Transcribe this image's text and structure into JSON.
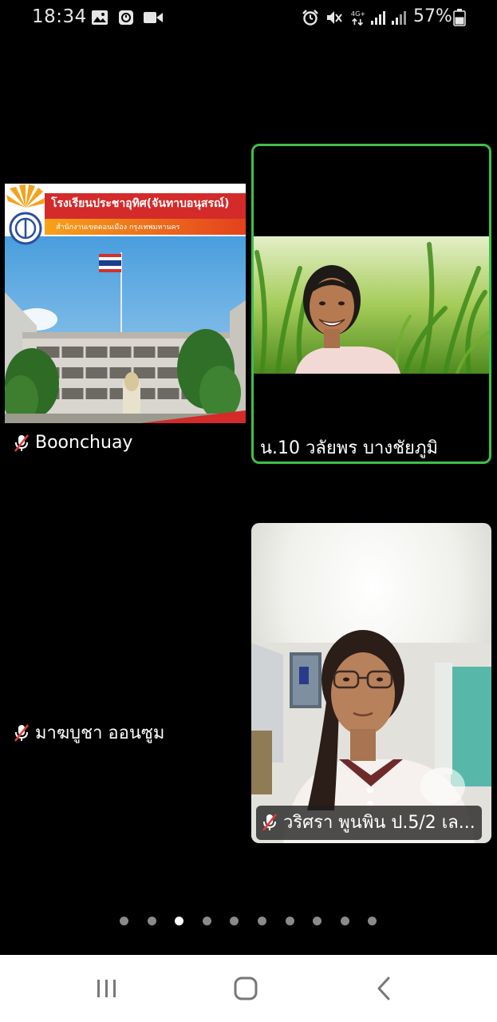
{
  "status_bar": {
    "time": "18:34",
    "left_icons": [
      "image-icon",
      "timer-icon",
      "video-icon"
    ],
    "right_icons": [
      "alarm-icon",
      "mute-vibrate-icon",
      "network-4g-plus-icon",
      "signal-icon",
      "signal-icon-2",
      "battery-icon"
    ],
    "network_label": "4G+",
    "battery_percent": "57%"
  },
  "participants": [
    {
      "name": "Boonchuay",
      "muted": true,
      "speaking": false,
      "video": "school-banner"
    },
    {
      "name": "น.10 วลัยพร บางชัยภูมิ",
      "muted": false,
      "speaking": true,
      "video": "camera"
    },
    {
      "name": "มาฆบูชา ออนซูม",
      "muted": true,
      "speaking": false,
      "video": "off"
    },
    {
      "name": "วริศรา พูนพิน ป.5/2 เล...",
      "muted": true,
      "speaking": false,
      "video": "camera"
    }
  ],
  "shared_banner": {
    "title": "โรงเรียนประชาอุทิศ(จันทาบอนุสรณ์)",
    "subtitle": "สำนักงานเขตดอนเมือง กรุงเทพมหานคร"
  },
  "page_indicator": {
    "total": 10,
    "current": 3
  },
  "nav_bar": {
    "buttons": [
      "recent-apps-icon",
      "home-icon",
      "back-icon"
    ]
  },
  "colors": {
    "active_speaker_border": "#3fbf4a",
    "muted_mic": "#e23b3b",
    "background": "#000000"
  }
}
